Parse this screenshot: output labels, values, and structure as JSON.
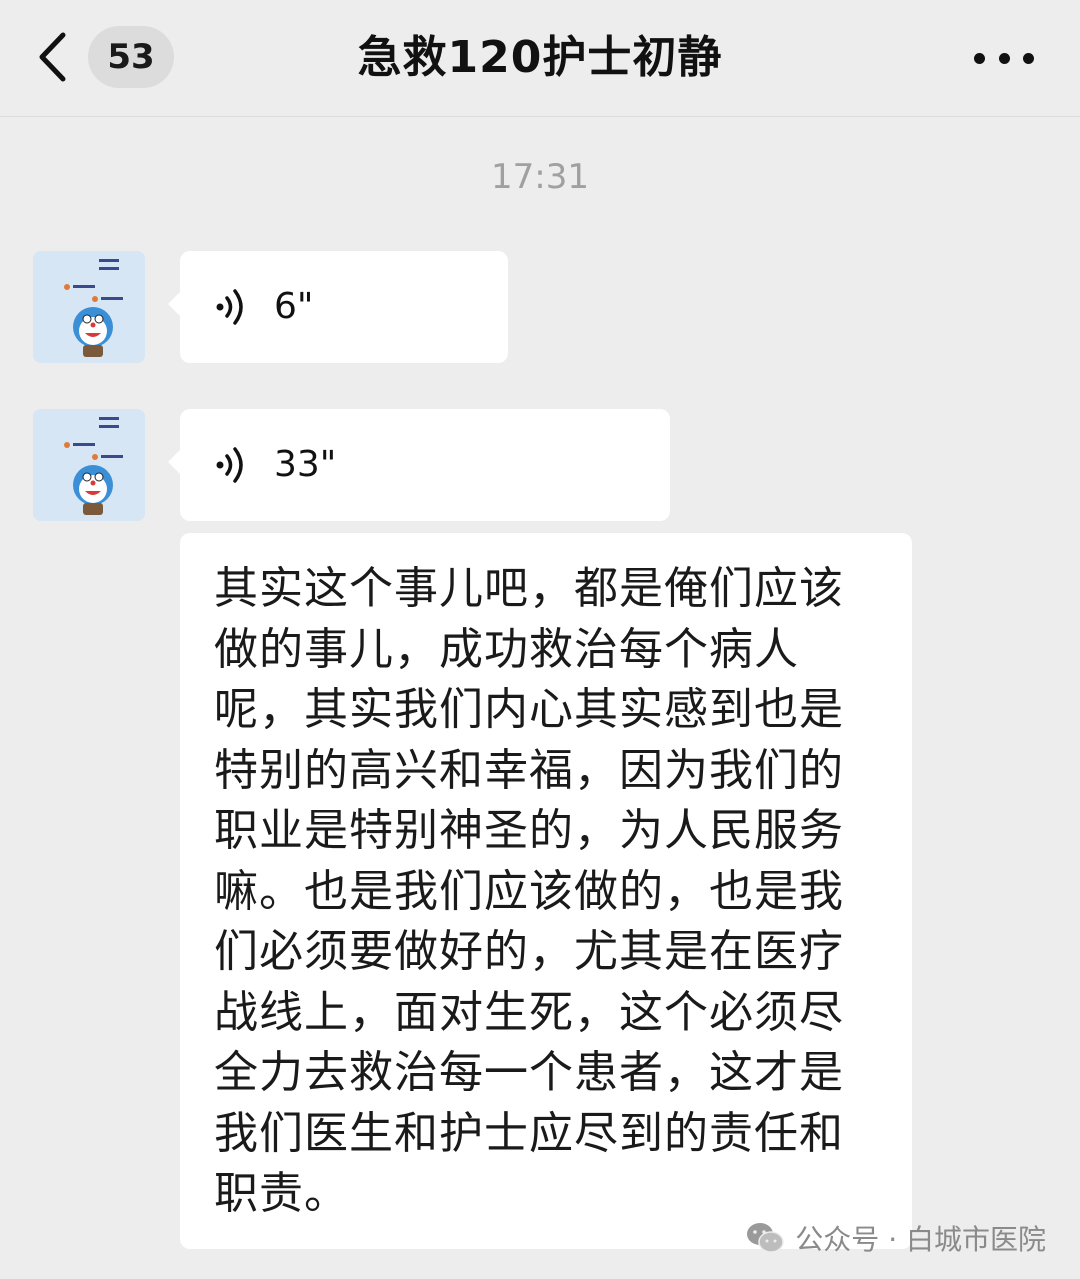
{
  "header": {
    "unread_count": "53",
    "title": "急救120护士初静",
    "back_icon": "chevron-left-icon",
    "more_icon": "more-dots-icon"
  },
  "timestamp": "17:31",
  "messages": [
    {
      "type": "voice",
      "duration": "6\""
    },
    {
      "type": "voice",
      "duration": "33\""
    },
    {
      "type": "text",
      "text": "其实这个事儿吧，都是俺们应该做的事儿，成功救治每个病人呢，其实我们内心其实感到也是特别的高兴和幸福，因为我们的职业是特别神圣的，为人民服务嘛。也是我们应该做的，也是我们必须要做好的，尤其是在医疗战线上，面对生死，这个必须尽全力去救治每一个患者，这才是我们医生和护士应尽到的责任和职责。"
    }
  ],
  "watermark": "公众号 · 白城市医院",
  "colors": {
    "background": "#ededed",
    "bubble": "#ffffff",
    "avatar_bg": "#d7e6f4"
  }
}
